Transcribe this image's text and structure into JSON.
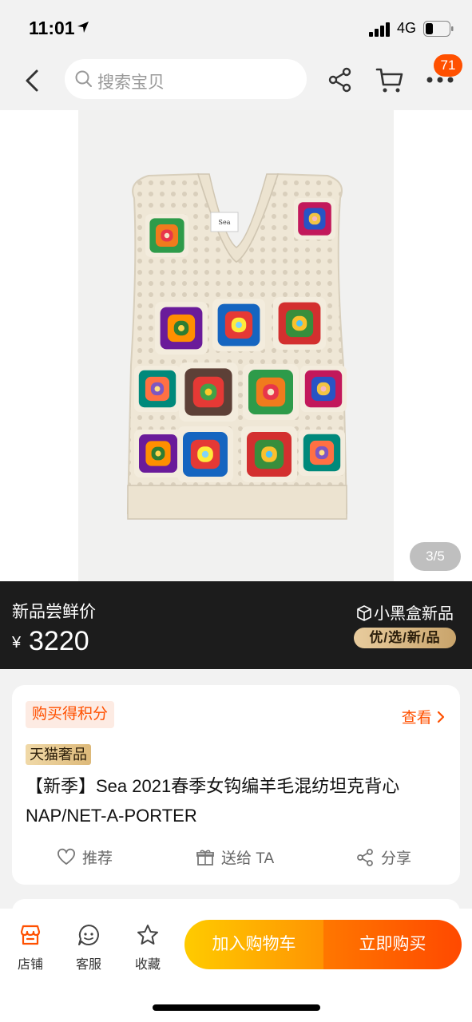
{
  "status_bar": {
    "time": "11:01",
    "network": "4G"
  },
  "nav": {
    "search_placeholder": "搜索宝贝",
    "cart_badge": "71",
    "icons": [
      "back-icon",
      "search-icon",
      "share-icon",
      "cart-icon",
      "more-icon"
    ]
  },
  "gallery": {
    "counter": "3/5",
    "garment_label": "Sea"
  },
  "price": {
    "label": "新品尝鲜价",
    "currency": "¥",
    "value": "3220",
    "brand_logo": "小黑盒新品",
    "brand_tag": "优/选/新/品"
  },
  "info": {
    "points_label": "购买得积分",
    "view_label": "查看",
    "store_tag": "天猫奢品",
    "title": "【新季】Sea 2021春季女钩编羊毛混纺坦克背心NAP/NET-A-PORTER",
    "actions": {
      "recommend": "推荐",
      "gift": "送给 TA",
      "share": "分享"
    }
  },
  "bottom": {
    "store": "店铺",
    "service": "客服",
    "favorite": "收藏",
    "add_to_cart": "加入购物车",
    "buy_now": "立即购买"
  },
  "colors": {
    "accent": "#ff5000",
    "cart_gradient": [
      "#ffcb00",
      "#ff9402"
    ],
    "buy_gradient": [
      "#ff7700",
      "#ff4900"
    ],
    "price_bar_bg": "#1c1c1c"
  }
}
